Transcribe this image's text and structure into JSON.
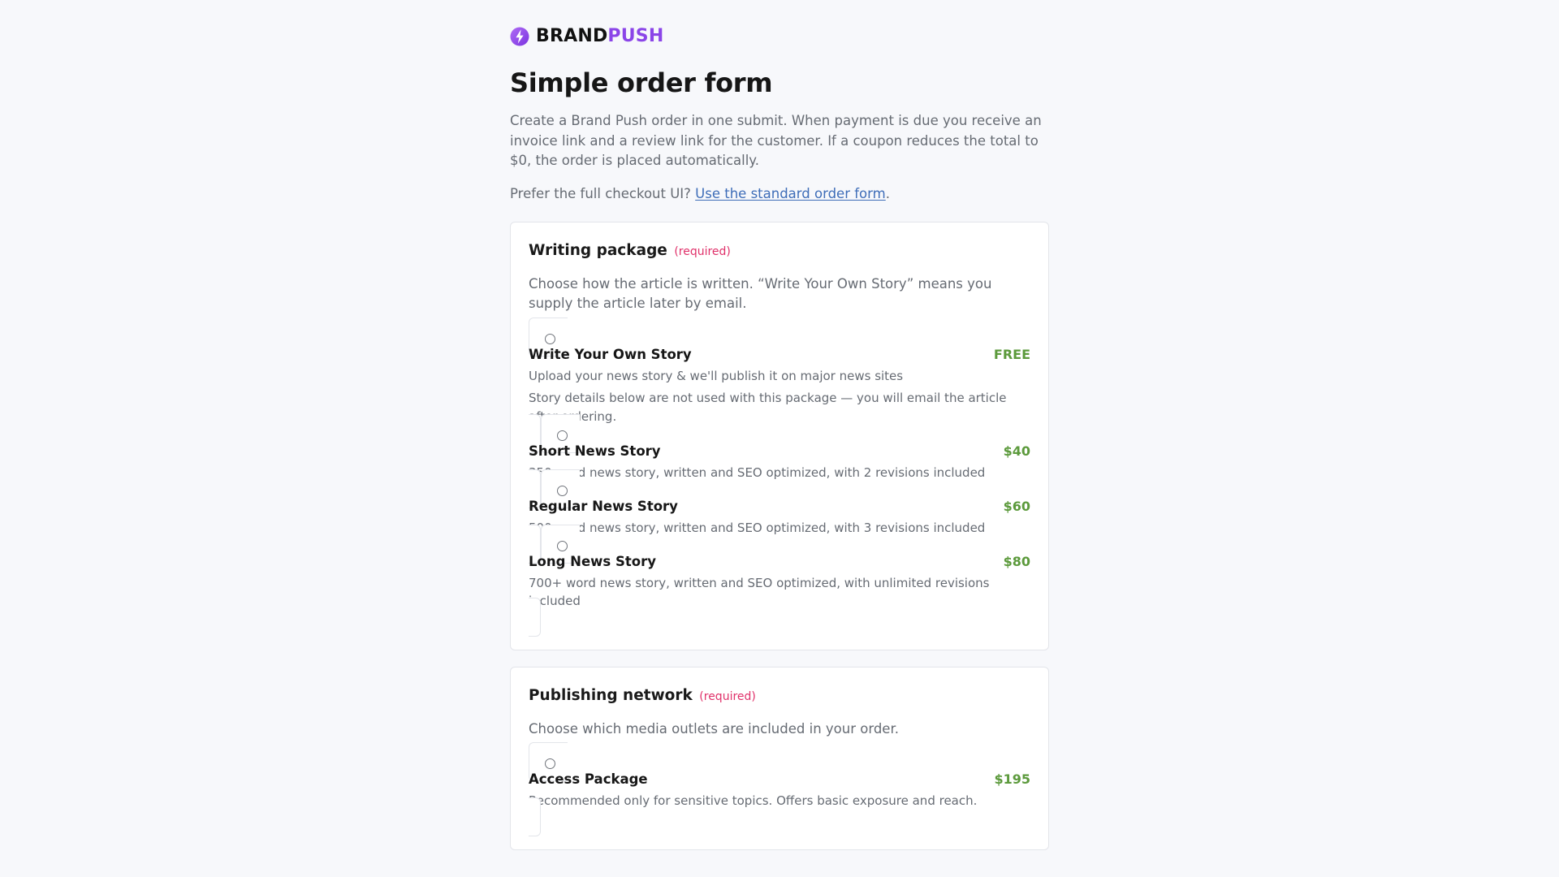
{
  "brand": {
    "name_part1": "BRAND",
    "name_part2": "PUSH",
    "logo_icon": "bolt-circle-icon",
    "accent_color": "#8b45e8"
  },
  "header": {
    "title": "Simple order form",
    "intro": "Create a Brand Push order in one submit. When payment is due you receive an invoice link and a review link for the customer. If a coupon reduces the total to $0, the order is placed automatically.",
    "prefer_text": "Prefer the full checkout UI?",
    "prefer_link": "Use the standard order form",
    "prefer_suffix": "."
  },
  "writing_package": {
    "title": "Writing package",
    "required_label": "(required)",
    "description": "Choose how the article is written. “Write Your Own Story” means you supply the article later by email.",
    "options": [
      {
        "name": "Write Your Own Story",
        "price": "FREE",
        "subtitle": "Upload your news story & we'll publish it on major news sites",
        "note": "Story details below are not used with this package — you will email the article after ordering."
      },
      {
        "name": "Short News Story",
        "price": "$40",
        "subtitle": "350 word news story, written and SEO optimized, with 2 revisions included"
      },
      {
        "name": "Regular News Story",
        "price": "$60",
        "subtitle": "500 word news story, written and SEO optimized, with 3 revisions included"
      },
      {
        "name": "Long News Story",
        "price": "$80",
        "subtitle": "700+ word news story, written and SEO optimized, with unlimited revisions included"
      }
    ]
  },
  "publishing_network": {
    "title": "Publishing network",
    "required_label": "(required)",
    "description": "Choose which media outlets are included in your order.",
    "options": [
      {
        "name": "Access Package",
        "price": "$195",
        "subtitle": "Recommended only for sensitive topics. Offers basic exposure and reach."
      }
    ]
  },
  "colors": {
    "price": "#5c9a3c",
    "required": "#e0316a",
    "link": "#3e6db8",
    "background": "#f7f8fb"
  }
}
